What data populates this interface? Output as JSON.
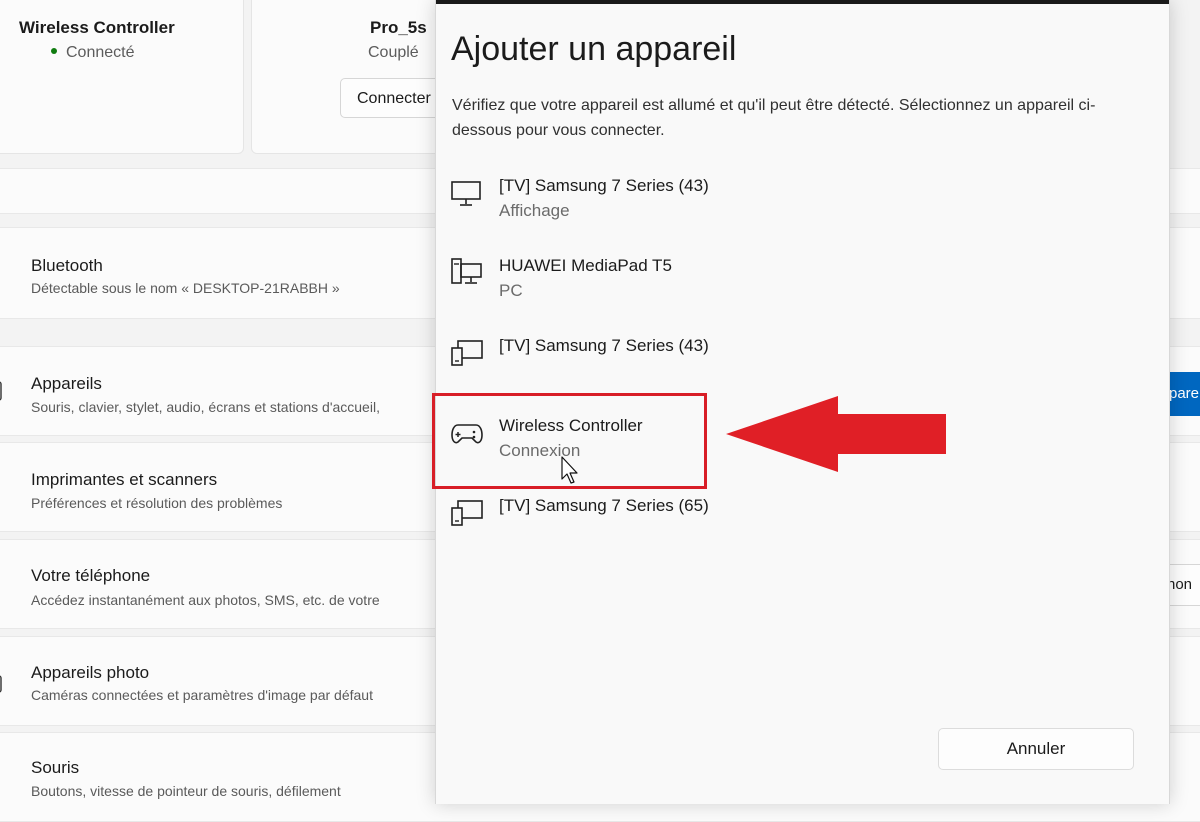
{
  "background": {
    "cards": [
      {
        "name": "Wireless Controller",
        "status": "Connecté"
      },
      {
        "name": "Pro_5s",
        "status": "Couplé",
        "button_label": "Connecter"
      }
    ],
    "rows": [
      {
        "title": "Bluetooth",
        "subtitle": "Détectable sous le nom « DESKTOP-21RABBH »"
      },
      {
        "title": "Appareils",
        "subtitle": "Souris, clavier, stylet, audio, écrans et stations d'accueil,",
        "edge_label": "pare"
      },
      {
        "title": "Imprimantes et scanners",
        "subtitle": "Préférences et résolution des problèmes"
      },
      {
        "title": "Votre téléphone",
        "subtitle": "Accédez instantanément aux photos, SMS, etc. de votre",
        "edge_label": "hon"
      },
      {
        "title": "Appareils photo",
        "subtitle": "Caméras connectées et paramètres d'image par défaut"
      },
      {
        "title": "Souris",
        "subtitle": "Boutons, vitesse de pointeur de souris, défilement"
      }
    ]
  },
  "dialog": {
    "title": "Ajouter un appareil",
    "description": "Vérifiez que votre appareil est allumé et qu'il peut être détecté. Sélectionnez un appareil ci-dessous pour vous connecter.",
    "devices": [
      {
        "name": "[TV] Samsung 7 Series (43)",
        "type": "Affichage",
        "icon": "monitor-icon"
      },
      {
        "name": "HUAWEI MediaPad T5",
        "type": "PC",
        "icon": "pc-icon"
      },
      {
        "name": "[TV] Samsung 7 Series (43)",
        "type": "",
        "icon": "devices-icon"
      },
      {
        "name": "Wireless Controller",
        "type": "Connexion",
        "icon": "gamepad-icon"
      },
      {
        "name": "[TV] Samsung 7 Series (65)",
        "type": "",
        "icon": "devices-icon"
      }
    ],
    "cancel_label": "Annuler"
  },
  "colors": {
    "accent": "#0067c0",
    "annotation_red": "#d81e27",
    "connected_green": "#107c10"
  }
}
